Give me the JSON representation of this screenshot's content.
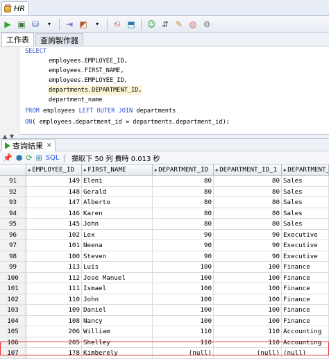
{
  "window": {
    "tab_label": "HR"
  },
  "subtabs": [
    "工作表",
    "查詢製作器"
  ],
  "editor": {
    "lines": [
      {
        "kw": "SELECT",
        "text": ""
      },
      {
        "kw": "",
        "text": "employees.EMPLOYEE_ID,"
      },
      {
        "kw": "",
        "text": "employees.FIRST_NAME,"
      },
      {
        "kw": "",
        "text": "employees.EMPLOYEE_ID,"
      },
      {
        "kw": "",
        "text": "departments.DEPARTMENT_ID,"
      },
      {
        "kw": "",
        "text": "department_name"
      },
      {
        "kw": "FROM",
        "text": " employees ",
        "kw2": "LEFT OUTER JOIN",
        "text2": " departments"
      },
      {
        "kw": "ON",
        "text": "( employees.department_id = departments.department_id);"
      }
    ]
  },
  "results": {
    "tab_label": "查詢結果",
    "sql_link": "SQL",
    "status": "擷取下 50 列 費時 0.013 秒",
    "columns": [
      "",
      "EMPLOYEE_ID",
      "FIRST_NAME",
      "DEPARTMENT_ID",
      "DEPARTMENT_ID_1",
      "DEPARTMENT_NAME"
    ],
    "rows": [
      [
        "91",
        "149",
        "Eleni",
        "80",
        "80",
        "Sales"
      ],
      [
        "92",
        "148",
        "Gerald",
        "80",
        "80",
        "Sales"
      ],
      [
        "93",
        "147",
        "Alberto",
        "80",
        "80",
        "Sales"
      ],
      [
        "94",
        "146",
        "Karen",
        "80",
        "80",
        "Sales"
      ],
      [
        "95",
        "145",
        "John",
        "80",
        "80",
        "Sales"
      ],
      [
        "96",
        "102",
        "Lex",
        "90",
        "90",
        "Executive"
      ],
      [
        "97",
        "101",
        "Neena",
        "90",
        "90",
        "Executive"
      ],
      [
        "98",
        "100",
        "Steven",
        "90",
        "90",
        "Executive"
      ],
      [
        "99",
        "113",
        "Luis",
        "100",
        "100",
        "Finance"
      ],
      [
        "100",
        "112",
        "Jose Manuel",
        "100",
        "100",
        "Finance"
      ],
      [
        "101",
        "111",
        "Ismael",
        "100",
        "100",
        "Finance"
      ],
      [
        "102",
        "110",
        "John",
        "100",
        "100",
        "Finance"
      ],
      [
        "103",
        "109",
        "Daniel",
        "100",
        "100",
        "Finance"
      ],
      [
        "104",
        "108",
        "Nancy",
        "100",
        "100",
        "Finance"
      ],
      [
        "105",
        "206",
        "William",
        "110",
        "110",
        "Accounting"
      ],
      [
        "106",
        "205",
        "Shelley",
        "110",
        "110",
        "Accounting"
      ],
      [
        "107",
        "178",
        "Kimberely",
        "(null)",
        "(null)",
        "(null)"
      ]
    ]
  }
}
